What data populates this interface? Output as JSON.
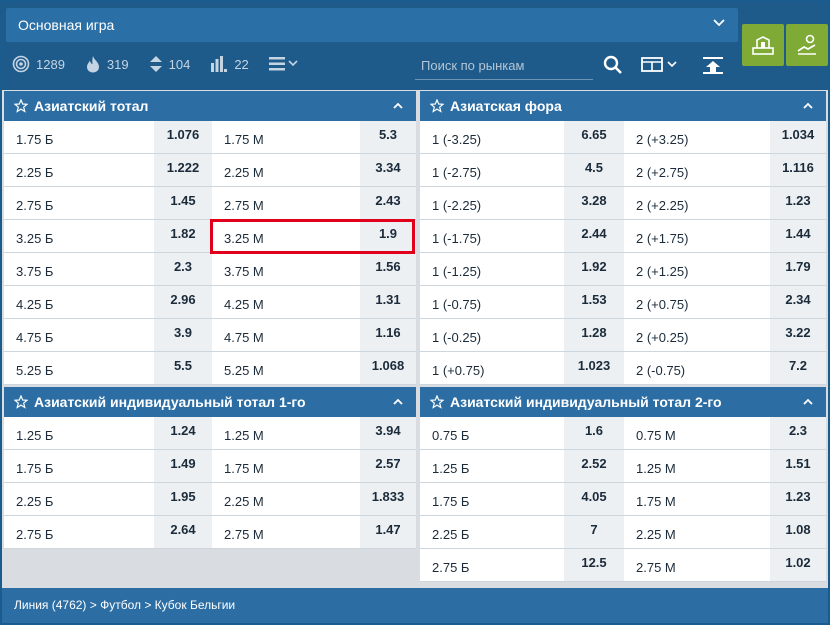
{
  "header": {
    "game_label": "Основная игра",
    "stats": [
      {
        "icon": "target-icon",
        "value": "1289"
      },
      {
        "icon": "flame-icon",
        "value": "319"
      },
      {
        "icon": "updown-arrows-icon",
        "value": "104"
      },
      {
        "icon": "bar-levels-icon",
        "value": "22"
      }
    ],
    "search_placeholder": "Поиск по рынкам"
  },
  "panels": [
    {
      "title": "Азиатский тотал",
      "rows": [
        {
          "l": "1.75 Б",
          "a": "1.076",
          "r": "1.75 М",
          "b": "5.3"
        },
        {
          "l": "2.25 Б",
          "a": "1.222",
          "r": "2.25 М",
          "b": "3.34"
        },
        {
          "l": "2.75 Б",
          "a": "1.45",
          "r": "2.75 М",
          "b": "2.43"
        },
        {
          "l": "3.25 Б",
          "a": "1.82",
          "r": "3.25 М",
          "b": "1.9"
        },
        {
          "l": "3.75 Б",
          "a": "2.3",
          "r": "3.75 М",
          "b": "1.56"
        },
        {
          "l": "4.25 Б",
          "a": "2.96",
          "r": "4.25 М",
          "b": "1.31"
        },
        {
          "l": "4.75 Б",
          "a": "3.9",
          "r": "4.75 М",
          "b": "1.16"
        },
        {
          "l": "5.25 Б",
          "a": "5.5",
          "r": "5.25 М",
          "b": "1.068"
        }
      ]
    },
    {
      "title": "Азиатская фора",
      "rows": [
        {
          "l": "1 (-3.25)",
          "a": "6.65",
          "r": "2 (+3.25)",
          "b": "1.034"
        },
        {
          "l": "1 (-2.75)",
          "a": "4.5",
          "r": "2 (+2.75)",
          "b": "1.116"
        },
        {
          "l": "1 (-2.25)",
          "a": "3.28",
          "r": "2 (+2.25)",
          "b": "1.23"
        },
        {
          "l": "1 (-1.75)",
          "a": "2.44",
          "r": "2 (+1.75)",
          "b": "1.44"
        },
        {
          "l": "1 (-1.25)",
          "a": "1.92",
          "r": "2 (+1.25)",
          "b": "1.79"
        },
        {
          "l": "1 (-0.75)",
          "a": "1.53",
          "r": "2 (+0.75)",
          "b": "2.34"
        },
        {
          "l": "1 (-0.25)",
          "a": "1.28",
          "r": "2 (+0.25)",
          "b": "3.22"
        },
        {
          "l": "1 (+0.75)",
          "a": "1.023",
          "r": "2 (-0.75)",
          "b": "7.2"
        }
      ]
    },
    {
      "title": "Азиатский индивидуальный тотал 1-го",
      "rows": [
        {
          "l": "1.25 Б",
          "a": "1.24",
          "r": "1.25 М",
          "b": "3.94"
        },
        {
          "l": "1.75 Б",
          "a": "1.49",
          "r": "1.75 М",
          "b": "2.57"
        },
        {
          "l": "2.25 Б",
          "a": "1.95",
          "r": "2.25 М",
          "b": "1.833"
        },
        {
          "l": "2.75 Б",
          "a": "2.64",
          "r": "2.75 М",
          "b": "1.47"
        }
      ]
    },
    {
      "title": "Азиатский индивидуальный тотал 2-го",
      "rows": [
        {
          "l": "0.75 Б",
          "a": "1.6",
          "r": "0.75 М",
          "b": "2.3"
        },
        {
          "l": "1.25 Б",
          "a": "2.52",
          "r": "1.25 М",
          "b": "1.51"
        },
        {
          "l": "1.75 Б",
          "a": "4.05",
          "r": "1.75 М",
          "b": "1.23"
        },
        {
          "l": "2.25 Б",
          "a": "7",
          "r": "2.25 М",
          "b": "1.08"
        },
        {
          "l": "2.75 Б",
          "a": "12.5",
          "r": "2.75 М",
          "b": "1.02"
        }
      ]
    }
  ],
  "highlighted_cell": {
    "panel": 0,
    "row": 3,
    "side": "right"
  },
  "footer": {
    "breadcrumb": "Линия (4762) > Футбол > Кубок Бельгии"
  },
  "colors": {
    "header": "#1e5a8a",
    "panel_head": "#2c6ea4",
    "accent_green": "#7eaa35",
    "highlight": "#e0001b"
  }
}
